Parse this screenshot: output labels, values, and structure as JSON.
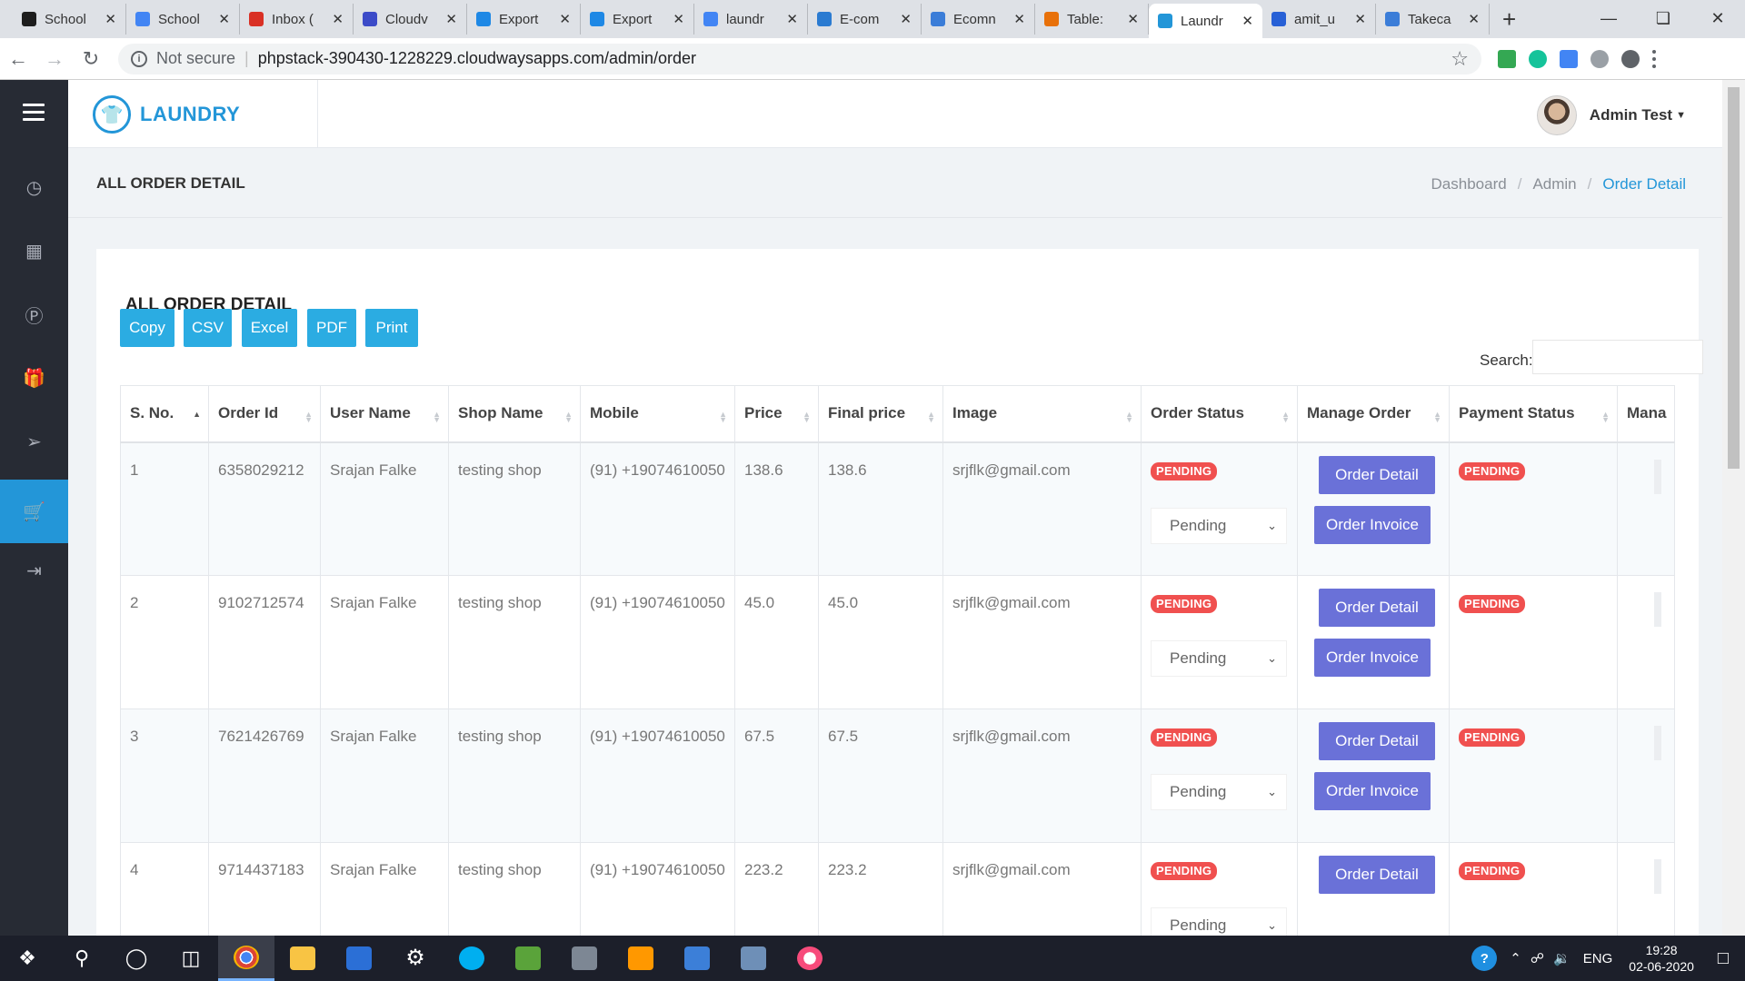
{
  "browser": {
    "tabs": [
      {
        "title": "School",
        "color": "#1d1d1d"
      },
      {
        "title": "School",
        "color": "#4285f4"
      },
      {
        "title": "Inbox (",
        "color": "#d93025"
      },
      {
        "title": "Cloudv",
        "color": "#3c4bc8"
      },
      {
        "title": "Export",
        "color": "#1e88e5"
      },
      {
        "title": "Export",
        "color": "#1e88e5"
      },
      {
        "title": "laundr",
        "color": "#4285f4"
      },
      {
        "title": "E-com",
        "color": "#2b7bd1"
      },
      {
        "title": "Ecomn",
        "color": "#3b7dd8"
      },
      {
        "title": "Table:",
        "color": "#e8710a"
      },
      {
        "title": "Laundr",
        "color": "#2396d8"
      },
      {
        "title": "amit_u",
        "color": "#2760d6"
      },
      {
        "title": "Takeca",
        "color": "#3b7dd8"
      }
    ],
    "active_tab": 10,
    "not_secure": "Not secure",
    "url": "phpstack-390430-1228229.cloudwaysapps.com/admin/order"
  },
  "app": {
    "brand": "LAUNDRY",
    "user_name": "Admin Test",
    "page_title": "ALL ORDER DETAIL",
    "breadcrumb": [
      "Dashboard",
      "Admin",
      "Order Detail"
    ],
    "card_title": "ALL ORDER DETAIL",
    "export_buttons": [
      "Copy",
      "CSV",
      "Excel",
      "PDF",
      "Print"
    ],
    "search_label": "Search:",
    "search_value": "",
    "columns": [
      "S. No.",
      "Order Id",
      "User Name",
      "Shop Name",
      "Mobile",
      "Price",
      "Final price",
      "Image",
      "Order Status",
      "Manage Order",
      "Payment Status",
      "Mana"
    ],
    "order_detail_label": "Order Detail",
    "order_invoice_label": "Order Invoice",
    "rows": [
      {
        "sno": "1",
        "order_id": "6358029212",
        "user": "Srajan Falke",
        "shop": "testing shop",
        "mobile": "(91) +19074610050",
        "price": "138.6",
        "final": "138.6",
        "image": "srjflk@gmail.com",
        "status": "PENDING",
        "select": "Pending",
        "payment": "PENDING"
      },
      {
        "sno": "2",
        "order_id": "9102712574",
        "user": "Srajan Falke",
        "shop": "testing shop",
        "mobile": "(91) +19074610050",
        "price": "45.0",
        "final": "45.0",
        "image": "srjflk@gmail.com",
        "status": "PENDING",
        "select": "Pending",
        "payment": "PENDING"
      },
      {
        "sno": "3",
        "order_id": "7621426769",
        "user": "Srajan Falke",
        "shop": "testing shop",
        "mobile": "(91) +19074610050",
        "price": "67.5",
        "final": "67.5",
        "image": "srjflk@gmail.com",
        "status": "PENDING",
        "select": "Pending",
        "payment": "PENDING"
      },
      {
        "sno": "4",
        "order_id": "9714437183",
        "user": "Srajan Falke",
        "shop": "testing shop",
        "mobile": "(91) +19074610050",
        "price": "223.2",
        "final": "223.2",
        "image": "srjflk@gmail.com",
        "status": "PENDING",
        "select": "Pending",
        "payment": "PENDING"
      }
    ]
  },
  "taskbar": {
    "lang": "ENG",
    "time": "19:28",
    "date": "02-06-2020"
  },
  "colors": {
    "accent": "#2396d8",
    "export_button": "#2bace2",
    "action_button": "#6a71d8",
    "badge": "#f0504f",
    "sidebar": "#272b34"
  }
}
